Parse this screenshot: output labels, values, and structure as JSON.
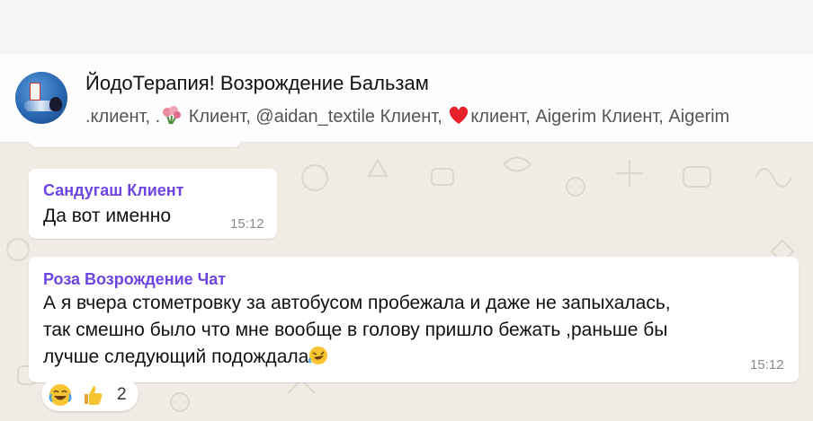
{
  "chat": {
    "title": "ЙодоТерапия! Возрождение Бальзам",
    "members_parts": [
      ".клиент, .",
      " Клиент, @aidan_textile Клиент, ",
      "клиент, Aigerim Клиент, Aigerim"
    ],
    "member_icons": [
      "bouquet-emoji",
      "red-heart-emoji"
    ]
  },
  "messages": [
    {
      "sender": "Сандугаш Клиент",
      "text": "Да вот именно",
      "time": "15:12"
    },
    {
      "sender": "Роза Возрождение Чат",
      "lines": [
        "А я вчера стометровку за автобусом пробежала и даже не запыхалась,",
        "так смешно было что мне вообще в голову пришло бежать ,раньше бы",
        "лучше следующий подождала"
      ],
      "trailing_icon": "rolling-on-floor-laughing-emoji",
      "time": "15:12",
      "reactions": {
        "icons": [
          "face-with-tears-of-joy-emoji",
          "thumbs-up-emoji"
        ],
        "count": "2"
      }
    }
  ],
  "colors": {
    "sender_name": "#6e45e2",
    "chat_background": "#f0ebe4",
    "bubble": "#ffffff",
    "timestamp": "#8a8a8a"
  }
}
